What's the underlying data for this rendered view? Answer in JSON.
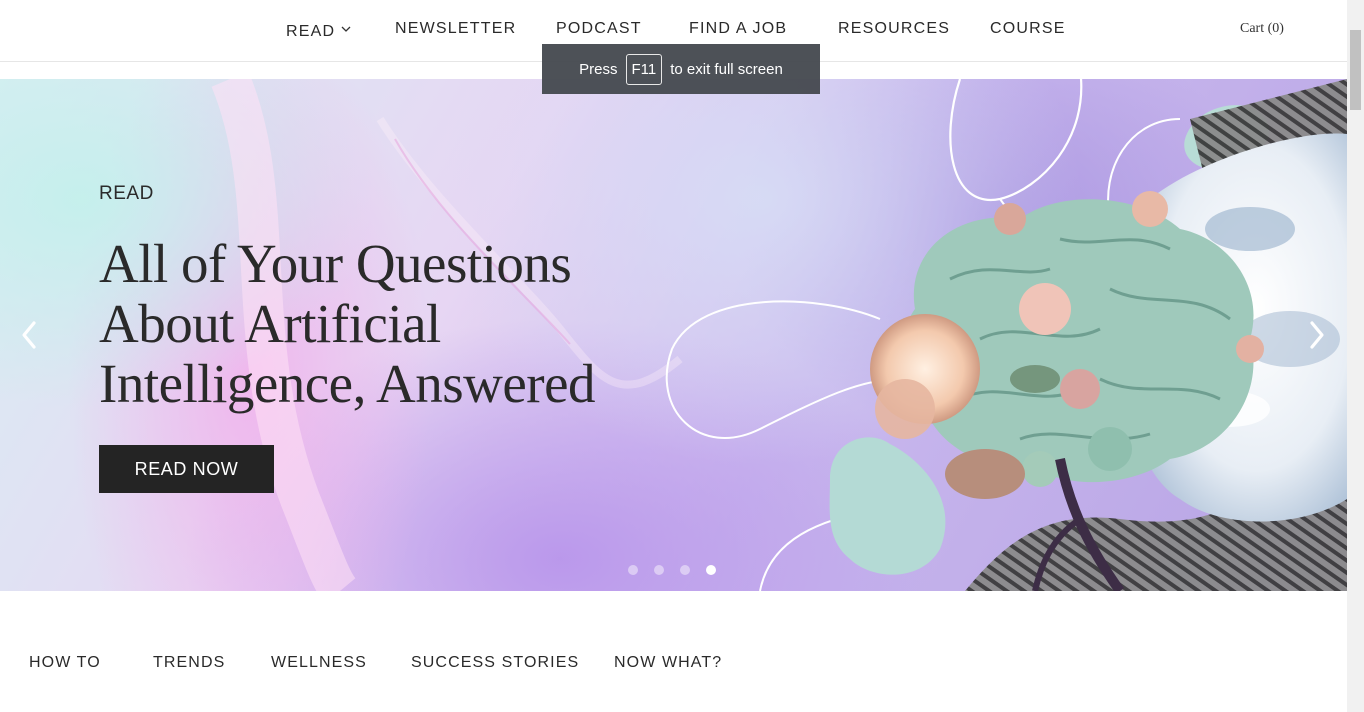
{
  "nav": {
    "items": [
      {
        "label": "READ",
        "has_dropdown": true
      },
      {
        "label": "NEWSLETTER"
      },
      {
        "label": "PODCAST"
      },
      {
        "label": "FIND A JOB"
      },
      {
        "label": "RESOURCES"
      },
      {
        "label": "COURSE"
      }
    ],
    "cart_label": "Cart (0)"
  },
  "fullscreen_toast": {
    "prefix": "Press",
    "key": "F11",
    "suffix": "to exit full screen"
  },
  "hero": {
    "eyebrow": "READ",
    "title_lines": [
      "All of Your Questions",
      "About Artificial",
      "Intelligence, Answered"
    ],
    "cta_label": "READ NOW",
    "slide_count": 4,
    "active_slide": 4,
    "prev_icon": "chevron-left-icon",
    "next_icon": "chevron-right-icon"
  },
  "categories": [
    "HOW TO",
    "TRENDS",
    "WELLNESS",
    "SUCCESS STORIES",
    "NOW WHAT?"
  ],
  "colors": {
    "cta_background": "#242424",
    "toast_background": "#464a50",
    "text": "#2a2a2a"
  }
}
